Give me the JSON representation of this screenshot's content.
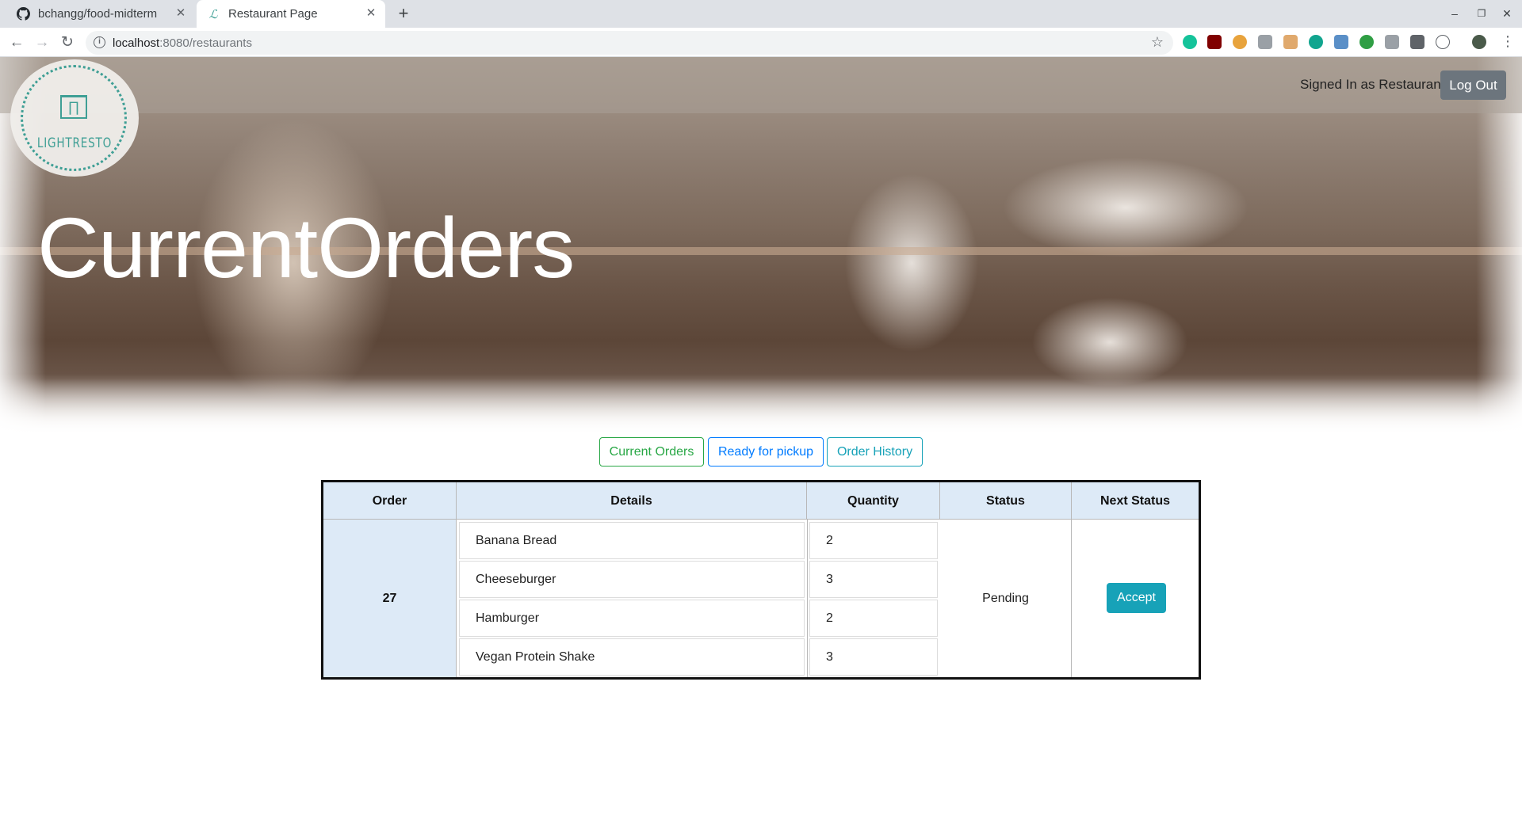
{
  "browser": {
    "tabs": [
      {
        "title": "bchangg/food-midterm",
        "icon": "github-icon",
        "active": false
      },
      {
        "title": "Restaurant Page",
        "icon": "lightresto-favicon",
        "active": true
      }
    ],
    "url_host": "localhost",
    "url_rest": ":8080/restaurants"
  },
  "header": {
    "logo_text": "LIGHTRESTO",
    "signed_in_text": "Signed In as Restaurant",
    "logout_label": "Log Out"
  },
  "page_title": "CurrentOrders",
  "filters": {
    "current_orders": "Current Orders",
    "ready_for_pickup": "Ready for pickup",
    "order_history": "Order History"
  },
  "table": {
    "headers": [
      "Order",
      "Details",
      "Quantity",
      "Status",
      "Next Status"
    ],
    "orders": [
      {
        "order_id": "27",
        "items": [
          {
            "name": "Banana Bread",
            "quantity": "2"
          },
          {
            "name": "Cheeseburger",
            "quantity": "3"
          },
          {
            "name": "Hamburger",
            "quantity": "2"
          },
          {
            "name": "Vegan Protein Shake",
            "quantity": "3"
          }
        ],
        "status": "Pending",
        "next_status_label": "Accept"
      }
    ]
  },
  "colors": {
    "accent_teal": "#17a2b8",
    "success_green": "#28a745",
    "primary_blue": "#007bff",
    "secondary_gray": "#6c757d",
    "header_cell_bg": "#ddeaf7"
  }
}
